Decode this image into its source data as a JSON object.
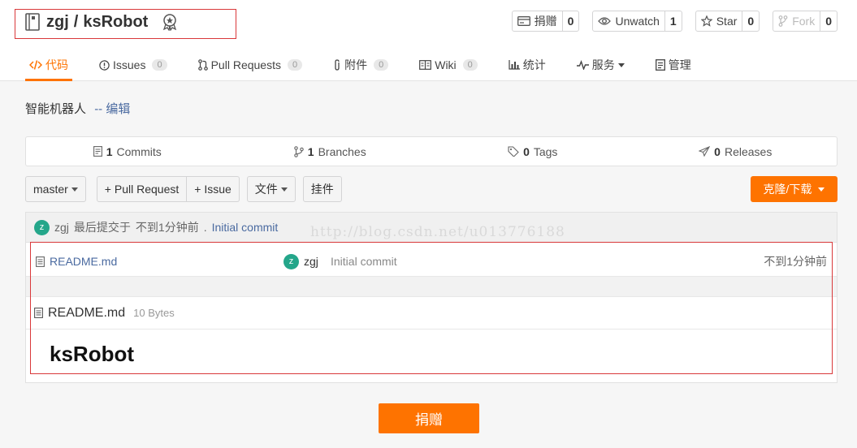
{
  "repo": {
    "owner": "zgj",
    "separator": "/",
    "name": "ksRobot"
  },
  "actions": [
    {
      "label": "捐赠",
      "count": "0",
      "icon": "card-icon"
    },
    {
      "label": "Unwatch",
      "count": "1",
      "icon": "eye-icon"
    },
    {
      "label": "Star",
      "count": "0",
      "icon": "star-icon"
    },
    {
      "label": "Fork",
      "count": "0",
      "icon": "fork-icon"
    }
  ],
  "tabs": [
    {
      "label": "代码",
      "count": "",
      "active": true
    },
    {
      "label": "Issues",
      "count": "0"
    },
    {
      "label": "Pull Requests",
      "count": "0"
    },
    {
      "label": "附件",
      "count": "0"
    },
    {
      "label": "Wiki",
      "count": "0"
    },
    {
      "label": "统计",
      "count": ""
    },
    {
      "label": "服务",
      "count": ""
    },
    {
      "label": "管理",
      "count": ""
    }
  ],
  "description": {
    "text": "智能机器人",
    "edit": "-- 编辑"
  },
  "stats": [
    {
      "num": "1",
      "label": "Commits"
    },
    {
      "num": "1",
      "label": "Branches"
    },
    {
      "num": "0",
      "label": "Tags"
    },
    {
      "num": "0",
      "label": "Releases"
    }
  ],
  "toolbar": {
    "branch": "master",
    "pull_request": "+ Pull Request",
    "issue": "+ Issue",
    "file": "文件",
    "widget": "挂件",
    "clone": "克隆/下载"
  },
  "last_commit": {
    "avatar": "z",
    "author": "zgj",
    "prefix": "最后提交于",
    "time": "不到1分钟前",
    "dot": ".",
    "message": "Initial commit"
  },
  "files": [
    {
      "name": "README.md",
      "avatar": "z",
      "author": "zgj",
      "message": "Initial commit",
      "time": "不到1分钟前"
    }
  ],
  "readme": {
    "name": "README.md",
    "size": "10 Bytes",
    "heading": "ksRobot"
  },
  "watermark": "http://blog.csdn.net/u013776188",
  "donate_button": "捐赠",
  "colors": {
    "accent": "#fe7300",
    "avatar": "#24a68a",
    "link": "#4a6aa0",
    "highlight_box": "#d9383a"
  }
}
